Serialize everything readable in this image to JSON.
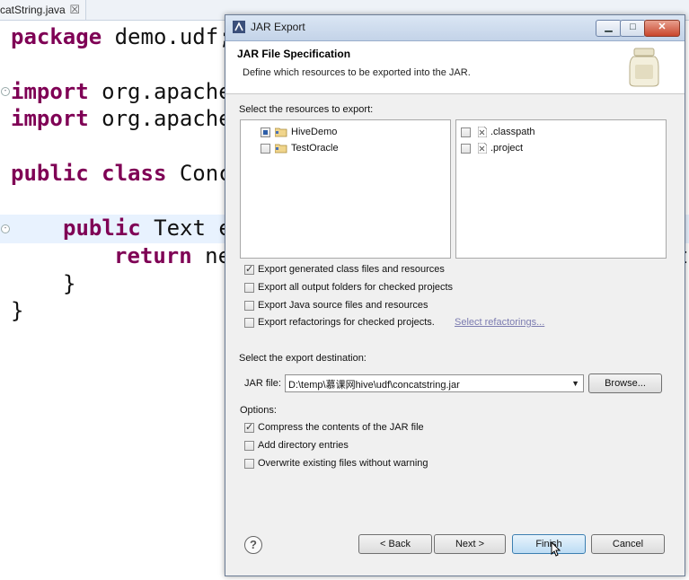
{
  "editor": {
    "tab_label": "catString.java",
    "tab_close": "☒",
    "code_lines": [
      {
        "kw": "package",
        "rest": " demo.udf;"
      },
      {
        "kw": "import",
        "rest": " org.apache"
      },
      {
        "kw": "import",
        "rest": " org.apache"
      },
      {
        "kw": "public class",
        "rest": " Conc"
      },
      {
        "kw": "public",
        "rest": " Text e"
      },
      {
        "kw": "return",
        "rest": " ne"
      },
      {
        "kw": "",
        "rest": "}"
      },
      {
        "kw": "",
        "rest": "}"
      }
    ],
    "partial_right_char": "t"
  },
  "dialog": {
    "title": "JAR Export",
    "banner_title": "JAR File Specification",
    "banner_desc": "Define which resources to be exported into the JAR.",
    "resources_label": "Select the resources to export:",
    "projects": [
      {
        "label": "HiveDemo",
        "state": "partial"
      },
      {
        "label": "TestOracle",
        "state": "unchecked"
      }
    ],
    "files": [
      {
        "label": ".classpath",
        "checked": false
      },
      {
        "label": ".project",
        "checked": false
      }
    ],
    "export_options": [
      {
        "label": "Export generated class files and resources",
        "checked": true
      },
      {
        "label": "Export all output folders for checked projects",
        "checked": false
      },
      {
        "label": "Export Java source files and resources",
        "checked": false
      },
      {
        "label": "Export refactorings for checked projects.",
        "checked": false
      }
    ],
    "select_refactorings_link": "Select refactorings...",
    "destination_label": "Select the export destination:",
    "jar_file_label": "JAR file:",
    "jar_file_value": "D:\\temp\\慕课网hive\\udf\\concatstring.jar",
    "browse_label": "Browse...",
    "options_label": "Options:",
    "options": [
      {
        "label": "Compress the contents of the JAR file",
        "checked": true
      },
      {
        "label": "Add directory entries",
        "checked": false
      },
      {
        "label": "Overwrite existing files without warning",
        "checked": false
      }
    ],
    "help_label": "?",
    "back_label": "< Back",
    "next_label": "Next >",
    "finish_label": "Finish",
    "cancel_label": "Cancel"
  },
  "icons": [
    "jar-icon",
    "minimize-icon",
    "maximize-icon",
    "close-icon",
    "folder-project-icon",
    "file-icon",
    "help-icon",
    "dropdown-arrow-icon",
    "mouse-cursor-icon"
  ]
}
